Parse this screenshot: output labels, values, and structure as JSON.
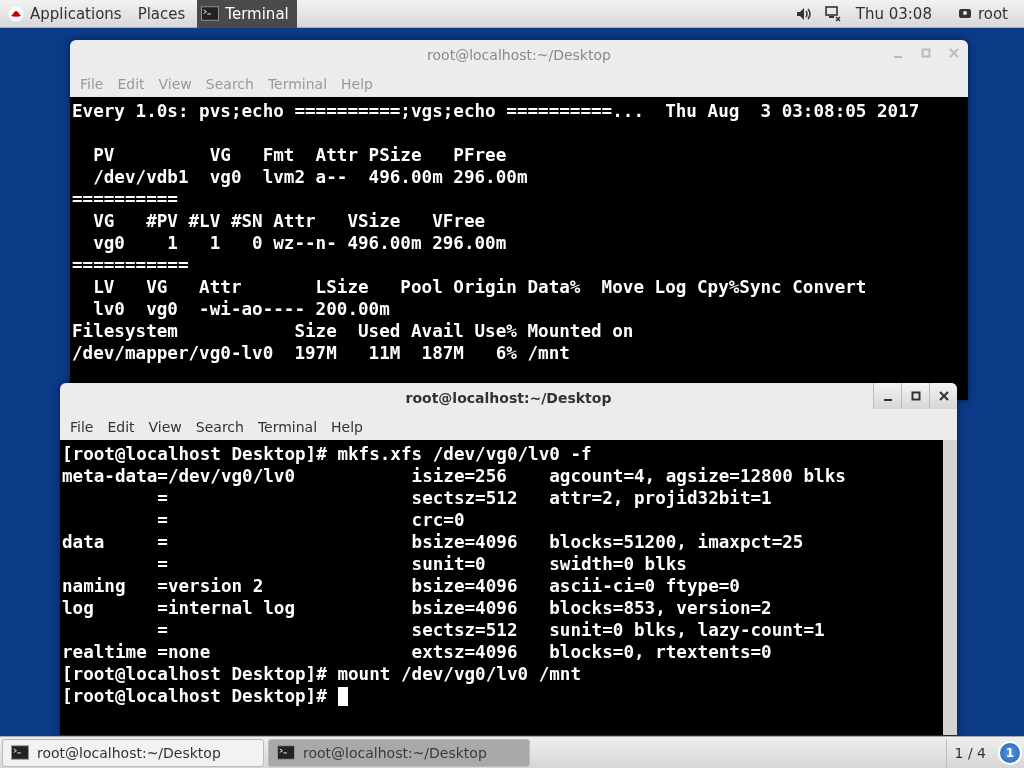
{
  "top_bar": {
    "applications": "Applications",
    "places": "Places",
    "active_app": "Terminal",
    "clock": "Thu 03:08",
    "user": "root"
  },
  "windows": [
    {
      "title": "root@localhost:~/Desktop",
      "focused": false,
      "menu": [
        "File",
        "Edit",
        "View",
        "Search",
        "Terminal",
        "Help"
      ],
      "cursor": false,
      "header": "Every 1.0s: pvs;echo ==========;vgs;echo ==========...  Thu Aug  3 03:08:05 2017",
      "lines": [
        "  PV         VG   Fmt  Attr PSize   PFree",
        "  /dev/vdb1  vg0  lvm2 a--  496.00m 296.00m",
        "==========",
        "  VG   #PV #LV #SN Attr   VSize   VFree",
        "  vg0    1   1   0 wz--n- 496.00m 296.00m",
        "===========",
        "  LV   VG   Attr       LSize   Pool Origin Data%  Move Log Cpy%Sync Convert",
        "  lv0  vg0  -wi-ao---- 200.00m",
        "Filesystem           Size  Used Avail Use% Mounted on",
        "/dev/mapper/vg0-lv0  197M   11M  187M   6% /mnt"
      ]
    },
    {
      "title": "root@localhost:~/Desktop",
      "focused": true,
      "menu": [
        "File",
        "Edit",
        "View",
        "Search",
        "Terminal",
        "Help"
      ],
      "cursor": true,
      "lines": [
        "[root@localhost Desktop]# mkfs.xfs /dev/vg0/lv0 -f",
        "meta-data=/dev/vg0/lv0           isize=256    agcount=4, agsize=12800 blks",
        "         =                       sectsz=512   attr=2, projid32bit=1",
        "         =                       crc=0",
        "data     =                       bsize=4096   blocks=51200, imaxpct=25",
        "         =                       sunit=0      swidth=0 blks",
        "naming   =version 2              bsize=4096   ascii-ci=0 ftype=0",
        "log      =internal log           bsize=4096   blocks=853, version=2",
        "         =                       sectsz=512   sunit=0 blks, lazy-count=1",
        "realtime =none                   extsz=4096   blocks=0, rtextents=0",
        "[root@localhost Desktop]# mount /dev/vg0/lv0 /mnt",
        "[root@localhost Desktop]#"
      ]
    }
  ],
  "taskbar": {
    "items": [
      {
        "label": "root@localhost:~/Desktop",
        "selected": false
      },
      {
        "label": "root@localhost:~/Desktop",
        "selected": true
      }
    ],
    "workspace": "1 / 4",
    "badge": "1"
  }
}
